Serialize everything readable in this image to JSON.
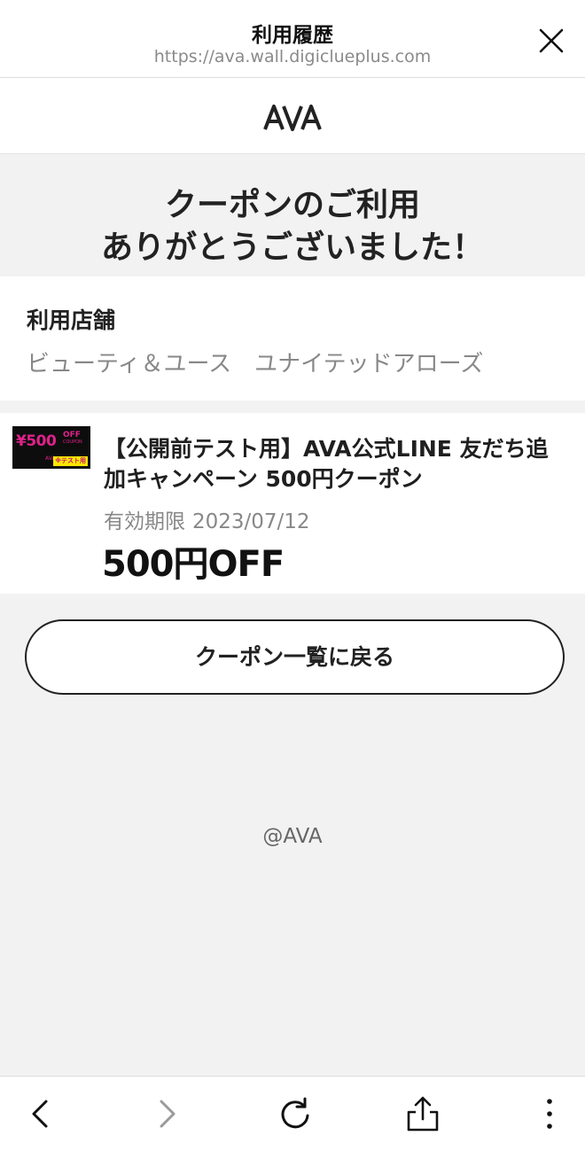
{
  "browser": {
    "title": "利用履歴",
    "url": "https://ava.wall.digiclueplus.com"
  },
  "site": {
    "logo_text": "AVA"
  },
  "thanks": {
    "line1": "クーポンのご利用",
    "line2": "ありがとうございました！"
  },
  "store": {
    "label": "利用店舗",
    "name": "ビューティ＆ユース　ユナイテッドアローズ"
  },
  "coupon": {
    "thumb_price": "¥500",
    "thumb_off": "OFF",
    "thumb_coupon": "COUPON",
    "thumb_ava": "AVA",
    "thumb_tag": "※テスト用",
    "title": "【公開前テスト用】AVA公式LINE 友だち追加キャンペーン 500円クーポン",
    "expiry_label": "有効期限",
    "expiry_date": "2023/07/12",
    "discount": "500円OFF"
  },
  "back_button": {
    "label": "クーポン一覧に戻る"
  },
  "footer": {
    "copyright": "@AVA"
  },
  "toolbar": {
    "icons": [
      "back-icon",
      "forward-icon",
      "reload-icon",
      "share-icon",
      "more-icon"
    ]
  },
  "colors": {
    "accent_pink": "#e0218a",
    "tag_yellow": "#ffe600",
    "text_dark": "#1f1f1f",
    "text_gray": "#888888",
    "background": "#f2f2f2"
  }
}
